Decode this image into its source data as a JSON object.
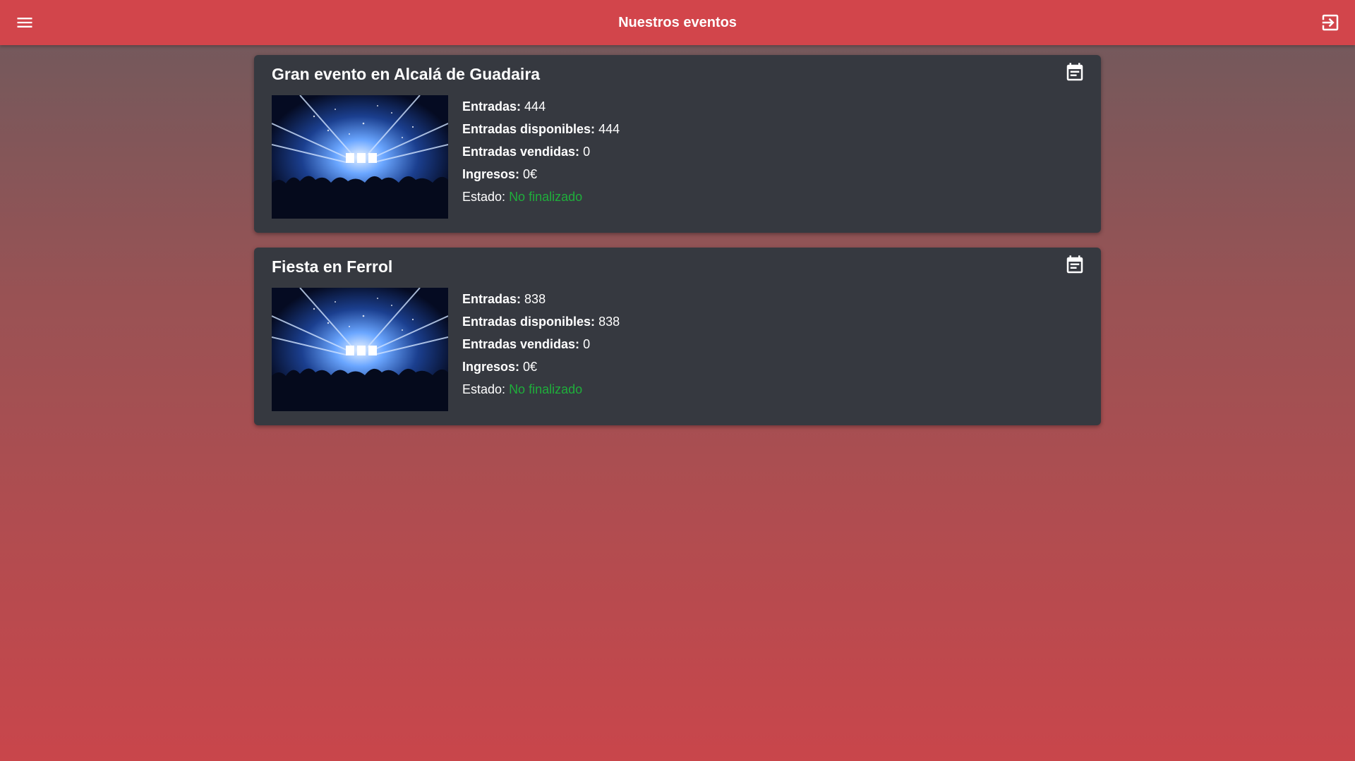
{
  "header": {
    "title": "Nuestros eventos",
    "menu_icon": "menu-icon",
    "logout_icon": "logout-icon"
  },
  "colors": {
    "topbar": "#d2454b",
    "card": "#363940",
    "status_ok": "#1fae3b"
  },
  "events": [
    {
      "title": "Gran evento en Alcalá de Guadaira",
      "icon": "calendar-icon",
      "entradas_label": "Entradas:",
      "entradas": "444",
      "disponibles_label": "Entradas disponibles:",
      "disponibles": "444",
      "vendidas_label": "Entradas vendidas:",
      "vendidas": "0",
      "ingresos_label": "Ingresos:",
      "ingresos": "0€",
      "estado_label": "Estado:",
      "estado": "No finalizado"
    },
    {
      "title": "Fiesta en Ferrol",
      "icon": "calendar-icon",
      "entradas_label": "Entradas:",
      "entradas": "838",
      "disponibles_label": "Entradas disponibles:",
      "disponibles": "838",
      "vendidas_label": "Entradas vendidas:",
      "vendidas": "0",
      "ingresos_label": "Ingresos:",
      "ingresos": "0€",
      "estado_label": "Estado:",
      "estado": "No finalizado"
    }
  ]
}
